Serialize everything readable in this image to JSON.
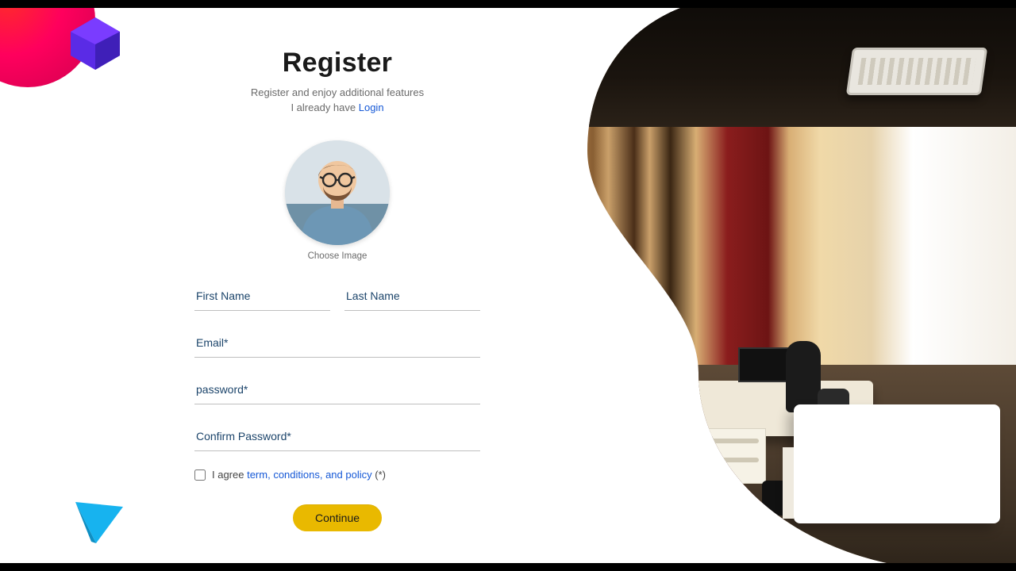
{
  "header": {
    "title": "Register",
    "subtitle": "Register and enjoy additional features",
    "already_have_prefix": "I already have ",
    "login_link": "Login"
  },
  "avatar": {
    "choose_label": "Choose Image"
  },
  "form": {
    "first_name": {
      "placeholder": "First Name",
      "value": ""
    },
    "last_name": {
      "placeholder": "Last Name",
      "value": ""
    },
    "email": {
      "placeholder": "Email*",
      "value": ""
    },
    "password": {
      "placeholder": "password*",
      "value": ""
    },
    "confirm_password": {
      "placeholder": "Confirm Password*",
      "value": ""
    },
    "agree_prefix": "I agree ",
    "agree_link": "term, conditions, and policy",
    "agree_suffix": " (*)",
    "agree_checked": false,
    "continue_label": "Continue"
  },
  "colors": {
    "link": "#1558d6",
    "button": "#e9b900"
  }
}
